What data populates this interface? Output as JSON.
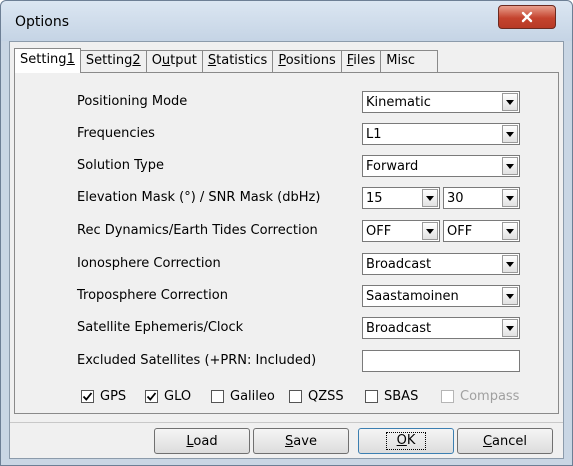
{
  "window": {
    "title": "Options"
  },
  "tabs": [
    {
      "pre": "Setting",
      "u": "1",
      "post": ""
    },
    {
      "pre": "Setting",
      "u": "2",
      "post": ""
    },
    {
      "pre": "O",
      "u": "u",
      "post": "tput"
    },
    {
      "pre": "",
      "u": "S",
      "post": "tatistics"
    },
    {
      "pre": "",
      "u": "P",
      "post": "ositions"
    },
    {
      "pre": "",
      "u": "F",
      "post": "iles"
    },
    {
      "pre": "Misc",
      "u": "",
      "post": ""
    }
  ],
  "settings": {
    "positioning_mode": {
      "label": "Positioning Mode",
      "value": "Kinematic"
    },
    "frequencies": {
      "label": "Frequencies",
      "value": "L1"
    },
    "solution_type": {
      "label": "Solution Type",
      "value": "Forward"
    },
    "elevation_mask": {
      "label": "Elevation Mask (°) / SNR Mask (dbHz)",
      "elev": "15",
      "snr": "30"
    },
    "rec_dynamics": {
      "label": "Rec Dynamics/Earth Tides Correction",
      "dyn": "OFF",
      "tides": "OFF"
    },
    "ionosphere": {
      "label": "Ionosphere Correction",
      "value": "Broadcast"
    },
    "troposphere": {
      "label": "Troposphere Correction",
      "value": "Saastamoinen"
    },
    "ephemeris": {
      "label": "Satellite Ephemeris/Clock",
      "value": "Broadcast"
    },
    "excluded": {
      "label": "Excluded Satellites (+PRN: Included)",
      "value": ""
    }
  },
  "systems": [
    {
      "label": "GPS",
      "checked": true,
      "enabled": true
    },
    {
      "label": "GLO",
      "checked": true,
      "enabled": true
    },
    {
      "label": "Galileo",
      "checked": false,
      "enabled": true
    },
    {
      "label": "QZSS",
      "checked": false,
      "enabled": true
    },
    {
      "label": "SBAS",
      "checked": false,
      "enabled": true
    },
    {
      "label": "Compass",
      "checked": false,
      "enabled": false
    }
  ],
  "buttons": {
    "load": {
      "u": "L",
      "rest": "oad"
    },
    "save": {
      "u": "S",
      "rest": "ave"
    },
    "ok": {
      "u": "O",
      "rest": "K"
    },
    "cancel": {
      "u": "C",
      "rest": "ancel"
    }
  },
  "icons": {
    "close": "close-x-icon",
    "dropdown": "dropdown-arrow-icon",
    "check": "checkmark-icon"
  }
}
